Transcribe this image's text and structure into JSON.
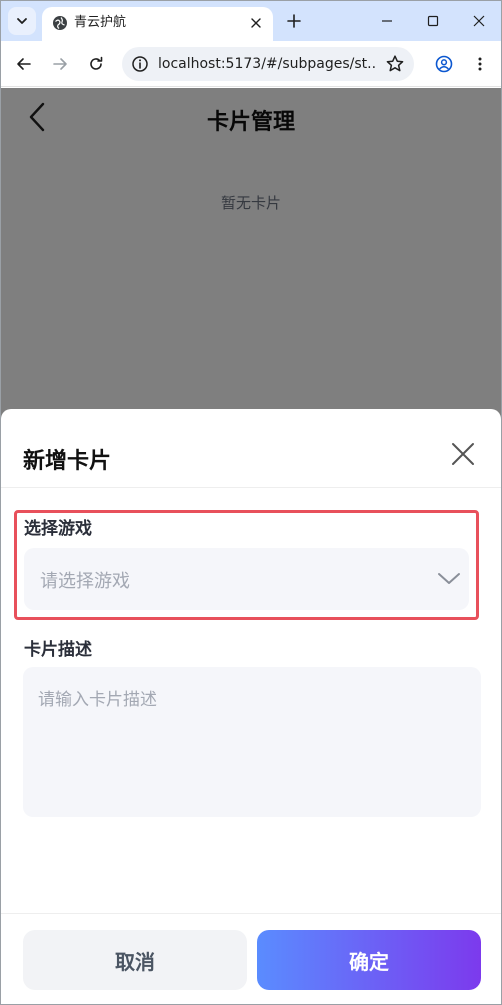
{
  "browser": {
    "tab": {
      "title": "青云护航",
      "favicon": "globe-icon"
    },
    "url": "localhost:5173/#/subpages/st...",
    "icons": {
      "tab_menu": "chevron-down-icon",
      "tab_close": "close-icon",
      "new_tab": "plus-icon",
      "minimize": "minimize-icon",
      "maximize": "maximize-icon",
      "close_window": "close-icon",
      "back": "arrow-left-icon",
      "forward": "arrow-right-icon",
      "reload": "reload-icon",
      "site_info": "info-icon",
      "bookmark": "star-icon",
      "profile": "profile-icon",
      "menu": "kebab-menu-icon"
    }
  },
  "page": {
    "header_title": "卡片管理",
    "empty_text": "暂无卡片",
    "back_icon": "chevron-left-icon"
  },
  "sheet": {
    "title": "新增卡片",
    "close_icon": "close-icon",
    "game_field": {
      "label": "选择游戏",
      "placeholder": "请选择游戏",
      "chevron_icon": "chevron-down-icon"
    },
    "description_field": {
      "label": "卡片描述",
      "placeholder": "请输入卡片描述"
    },
    "cancel_label": "取消",
    "confirm_label": "确定"
  },
  "colors": {
    "tab_strip": "#d3e3fd",
    "highlight": "#e8505b",
    "confirm_gradient_start": "#5a8cff",
    "confirm_gradient_end": "#7c3aed",
    "placeholder": "#a3a8b3",
    "field_background": "#f5f6fa"
  }
}
